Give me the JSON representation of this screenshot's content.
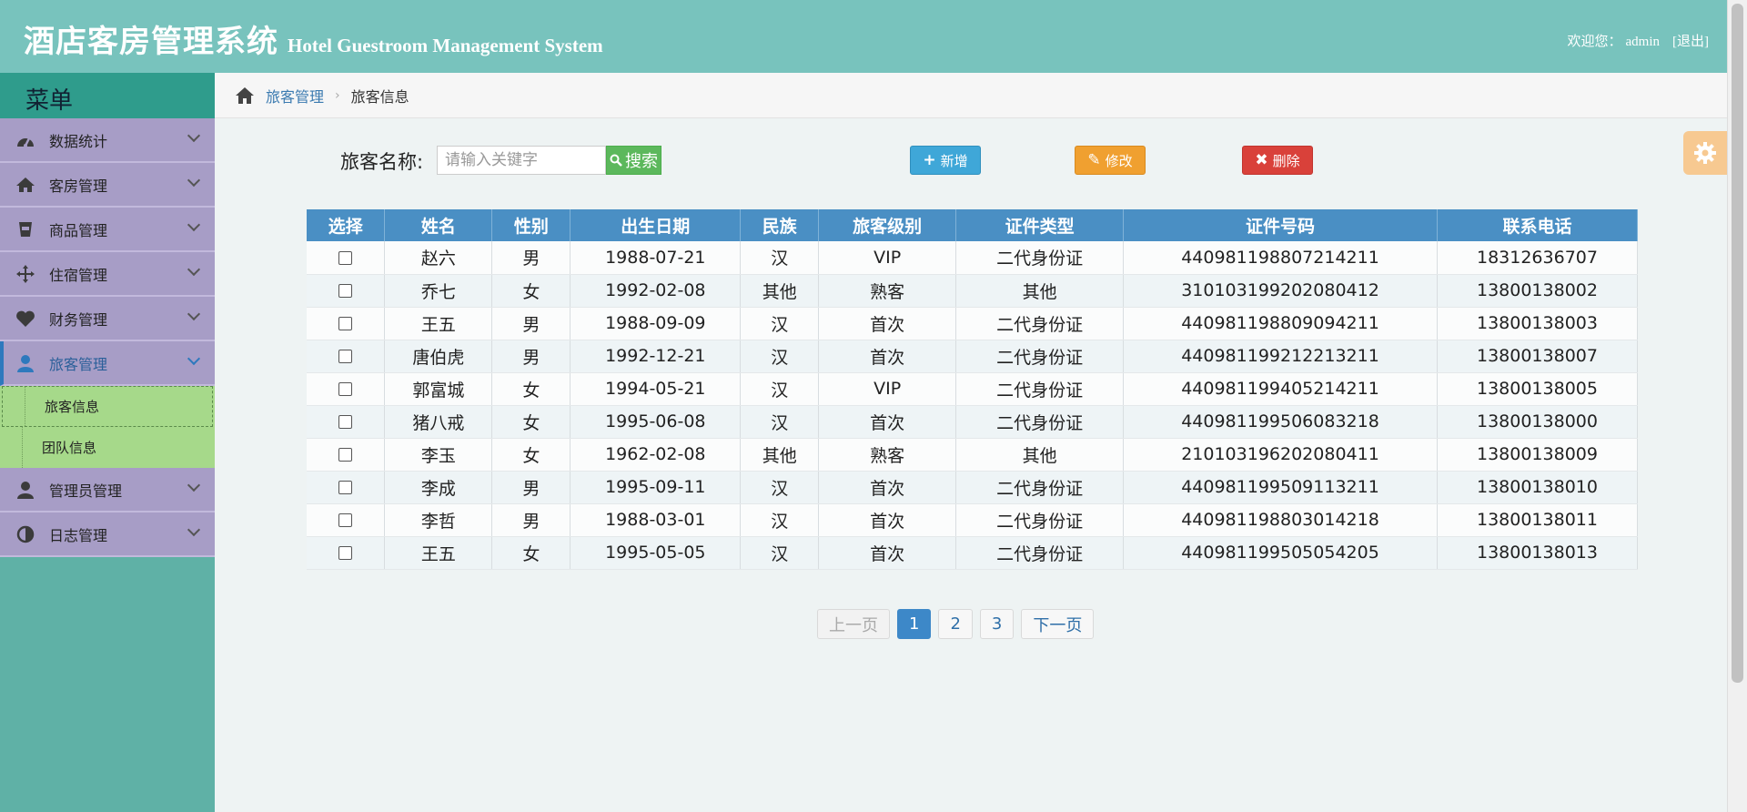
{
  "header": {
    "title_cn": "酒店客房管理系统",
    "title_en": "Hotel Guestroom Management System",
    "welcome": "欢迎您：",
    "username": "admin",
    "logout": "[退出]"
  },
  "sidebar": {
    "title": "菜单",
    "items": [
      {
        "label": "数据统计",
        "icon": "dashboard-icon"
      },
      {
        "label": "客房管理",
        "icon": "home-icon"
      },
      {
        "label": "商品管理",
        "icon": "cup-icon"
      },
      {
        "label": "住宿管理",
        "icon": "move-icon"
      },
      {
        "label": "财务管理",
        "icon": "heart-icon"
      },
      {
        "label": "旅客管理",
        "icon": "user-icon"
      },
      {
        "label": "管理员管理",
        "icon": "user-icon"
      },
      {
        "label": "日志管理",
        "icon": "contrast-icon"
      }
    ],
    "subitems": [
      {
        "label": "旅客信息"
      },
      {
        "label": "团队信息"
      }
    ]
  },
  "breadcrumb": {
    "parent": "旅客管理",
    "current": "旅客信息"
  },
  "toolbar": {
    "search_label": "旅客名称:",
    "search_placeholder": "请输入关键字",
    "search_button": "搜索",
    "add_button": "新增",
    "edit_button": "修改",
    "delete_button": "删除"
  },
  "table": {
    "headers": [
      "选择",
      "姓名",
      "性别",
      "出生日期",
      "民族",
      "旅客级别",
      "证件类型",
      "证件号码",
      "联系电话"
    ],
    "rows": [
      [
        "赵六",
        "男",
        "1988-07-21",
        "汉",
        "VIP",
        "二代身份证",
        "440981198807214211",
        "18312636707"
      ],
      [
        "乔七",
        "女",
        "1992-02-08",
        "其他",
        "熟客",
        "其他",
        "310103199202080412",
        "13800138002"
      ],
      [
        "王五",
        "男",
        "1988-09-09",
        "汉",
        "首次",
        "二代身份证",
        "440981198809094211",
        "13800138003"
      ],
      [
        "唐伯虎",
        "男",
        "1992-12-21",
        "汉",
        "首次",
        "二代身份证",
        "440981199212213211",
        "13800138007"
      ],
      [
        "郭富城",
        "女",
        "1994-05-21",
        "汉",
        "VIP",
        "二代身份证",
        "440981199405214211",
        "13800138005"
      ],
      [
        "猪八戒",
        "女",
        "1995-06-08",
        "汉",
        "首次",
        "二代身份证",
        "440981199506083218",
        "13800138000"
      ],
      [
        "李玉",
        "女",
        "1962-02-08",
        "其他",
        "熟客",
        "其他",
        "210103196202080411",
        "13800138009"
      ],
      [
        "李成",
        "男",
        "1995-09-11",
        "汉",
        "首次",
        "二代身份证",
        "440981199509113211",
        "13800138010"
      ],
      [
        "李哲",
        "男",
        "1988-03-01",
        "汉",
        "首次",
        "二代身份证",
        "440981198803014218",
        "13800138011"
      ],
      [
        "王五",
        "女",
        "1995-05-05",
        "汉",
        "首次",
        "二代身份证",
        "440981199505054205",
        "13800138013"
      ]
    ]
  },
  "pagination": {
    "prev": "上一页",
    "pages": [
      "1",
      "2",
      "3"
    ],
    "current": "1",
    "next": "下一页"
  },
  "colors": {
    "header_bg": "#78c3bd",
    "sidebar_item_bg": "#a79dc6",
    "submenu_bg": "#a6d98a",
    "table_header_bg": "#4a8fc4"
  }
}
